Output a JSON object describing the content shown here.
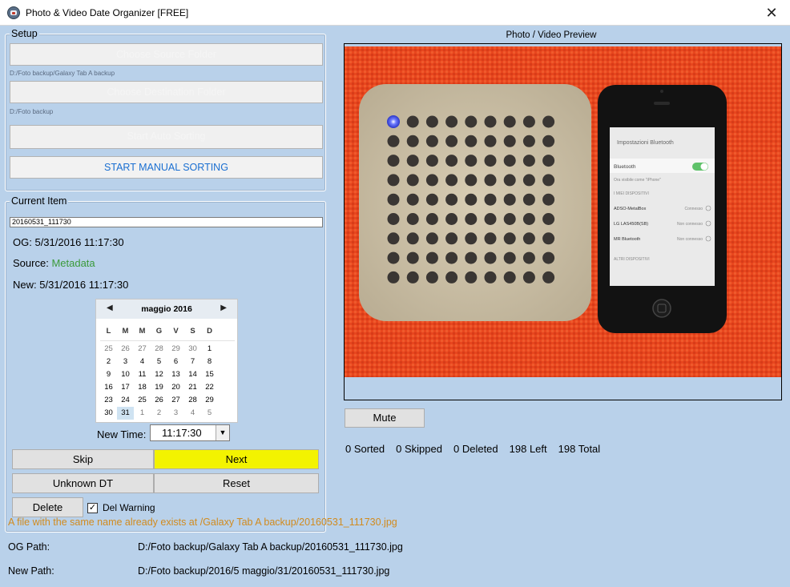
{
  "window": {
    "title": "Photo & Video Date Organizer [FREE]",
    "close_glyph": "✕"
  },
  "setup": {
    "legend": "Setup",
    "choose_source_label": "Choose Source Folder",
    "source_path": "D:/Foto backup/Galaxy Tab A backup",
    "choose_destination_label": "Choose Destination Folder",
    "destination_path": "D:/Foto backup",
    "auto_sort_label": "Start Auto Sorting",
    "manual_sort_label": "START MANUAL SORTING"
  },
  "current": {
    "legend": "Current Item",
    "filename": "20160531_111730",
    "og_label": "OG:",
    "og_value": "5/31/2016 11:17:30",
    "source_label": "Source:",
    "source_value": "Metadata",
    "new_label": "New:",
    "new_value": "5/31/2016  11:17:30"
  },
  "calendar": {
    "month": "maggio 2016",
    "prev_glyph": "◀",
    "next_glyph": "▶",
    "weekdays": [
      "L",
      "M",
      "M",
      "G",
      "V",
      "S",
      "D"
    ],
    "weeks": [
      [
        "25",
        "26",
        "27",
        "28",
        "29",
        "30",
        "1"
      ],
      [
        "2",
        "3",
        "4",
        "5",
        "6",
        "7",
        "8"
      ],
      [
        "9",
        "10",
        "11",
        "12",
        "13",
        "14",
        "15"
      ],
      [
        "16",
        "17",
        "18",
        "19",
        "20",
        "21",
        "22"
      ],
      [
        "23",
        "24",
        "25",
        "26",
        "27",
        "28",
        "29"
      ],
      [
        "30",
        "31",
        "1",
        "2",
        "3",
        "4",
        "5"
      ]
    ],
    "selected": "31"
  },
  "time": {
    "label": "New Time:",
    "value": "11:17:30",
    "dropdown_glyph": "▼"
  },
  "actions": {
    "skip": "Skip",
    "next": "Next",
    "unknown": "Unknown DT",
    "reset": "Reset",
    "delete": "Delete",
    "del_warning": "Del Warning",
    "del_warning_checked": true,
    "check_glyph": "✓"
  },
  "warning_text": "A file with the same name already exists at /Galaxy Tab A backup/20160531_111730.jpg",
  "preview": {
    "label": "Photo / Video Preview",
    "mute": "Mute",
    "phone_header": "Impostazioni   Bluetooth",
    "phone_bluetooth": "Bluetooth",
    "phone_visible": "Ora visibile come \"iPhone\"",
    "phone_devices_header": "I MIEI DISPOSITIVI",
    "phone_devices": [
      {
        "name": "ADSO-MetalBox",
        "status": "Connesso"
      },
      {
        "name": "LG LAS450B(SB)",
        "status": "Non connesso"
      },
      {
        "name": "MR Bluetooth",
        "status": "Non connesso"
      }
    ],
    "phone_other": "ALTRI DISPOSITIVI"
  },
  "stats": {
    "sorted": "0 Sorted",
    "skipped": "0 Skipped",
    "deleted": "0 Deleted",
    "left": "198 Left",
    "total": "198 Total"
  },
  "paths": {
    "og_label": "OG Path:",
    "og_value": "D:/Foto backup/Galaxy Tab A backup/20160531_111730.jpg",
    "new_label": "New Path:",
    "new_value": "D:/Foto backup/2016/5 maggio/31/20160531_111730.jpg"
  }
}
